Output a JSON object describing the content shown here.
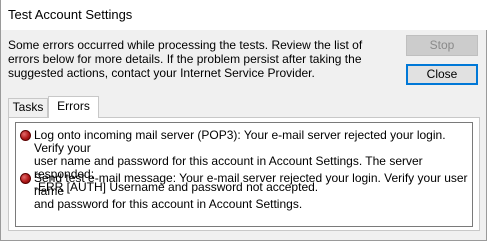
{
  "window": {
    "title": "Test Account Settings"
  },
  "message": "Some errors occurred while processing the tests. Review the list of errors below for more details. If the problem persist after taking the suggested actions, contact your Internet Service Provider.",
  "buttons": {
    "stop_label": "Stop",
    "close_label": "Close"
  },
  "tabs": [
    {
      "label": "Tasks",
      "selected": false
    },
    {
      "label": "Errors",
      "selected": true
    }
  ],
  "errors": [
    {
      "icon": "error-icon",
      "text": "Log onto incoming mail server (POP3): Your e-mail server rejected your login. Verify your\nuser name and password for this account in Account Settings.  The server responded:\n-ERR [AUTH] Username and password not accepted."
    },
    {
      "icon": "error-icon",
      "text": "Send test e-mail message: Your e-mail server rejected your login. Verify your user name\nand password for this account in Account Settings."
    }
  ],
  "colors": {
    "focus_border": "#0078d7",
    "error_icon": "#b01818"
  }
}
